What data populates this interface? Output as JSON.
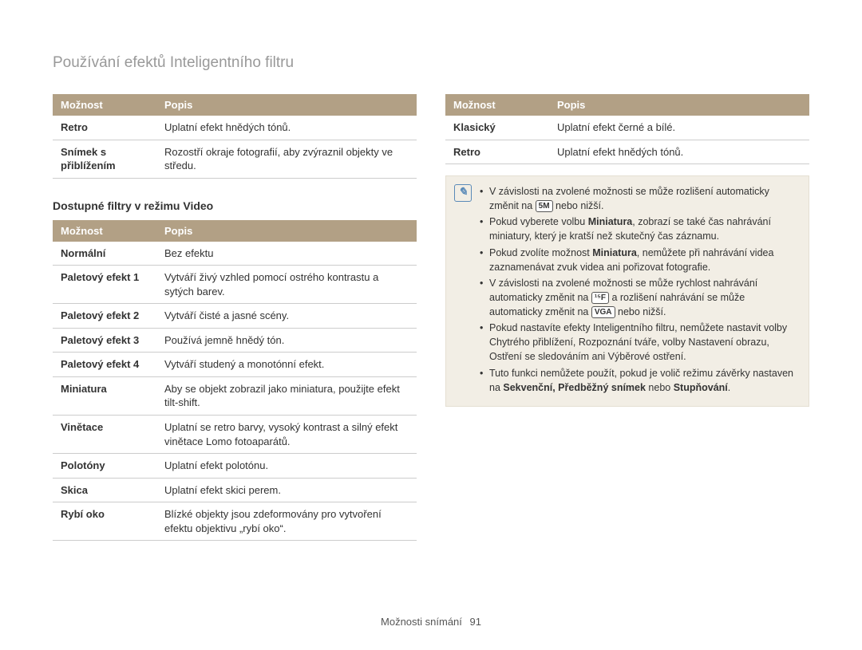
{
  "page_title": "Používání efektů Inteligentního filtru",
  "col_headers": {
    "option": "Možnost",
    "desc": "Popis"
  },
  "table_top_left": [
    {
      "opt": "Retro",
      "desc": "Uplatní efekt hnědých tónů."
    },
    {
      "opt": "Snímek s přiblížením",
      "desc": "Rozostří okraje fotografií, aby zvýraznil objekty ve středu."
    }
  ],
  "subhead_video": "Dostupné filtry v režimu Video",
  "table_video": [
    {
      "opt": "Normální",
      "desc": "Bez efektu"
    },
    {
      "opt": "Paletový efekt 1",
      "desc": "Vytváří živý vzhled pomocí ostrého kontrastu a sytých barev."
    },
    {
      "opt": "Paletový efekt 2",
      "desc": "Vytváří čisté a jasné scény."
    },
    {
      "opt": "Paletový efekt 3",
      "desc": "Používá jemně hnědý tón."
    },
    {
      "opt": "Paletový efekt 4",
      "desc": "Vytváří studený a monotónní efekt."
    },
    {
      "opt": "Miniatura",
      "desc": "Aby se objekt zobrazil jako miniatura, použijte efekt tilt-shift."
    },
    {
      "opt": "Vinětace",
      "desc": "Uplatní se retro barvy, vysoký kontrast a silný efekt vinětace Lomo fotoaparátů."
    },
    {
      "opt": "Polotóny",
      "desc": "Uplatní efekt polotónu."
    },
    {
      "opt": "Skica",
      "desc": "Uplatní efekt skici perem."
    },
    {
      "opt": "Rybí oko",
      "desc": "Blízké objekty jsou zdeformovány pro vytvoření efektu objektivu „rybí oko“."
    }
  ],
  "table_top_right": [
    {
      "opt": "Klasický",
      "desc": "Uplatní efekt černé a bílé."
    },
    {
      "opt": "Retro",
      "desc": "Uplatní efekt hnědých tónů."
    }
  ],
  "notes": {
    "n1a": "V závislosti na zvolené možnosti se může rozlišení automaticky změnit na ",
    "n1badge": "5M",
    "n1b": " nebo nižší.",
    "n2a": "Pokud vyberete volbu ",
    "n2bold": "Miniatura",
    "n2b": ", zobrazí se také čas nahrávání miniatury, který je kratší než skutečný čas záznamu.",
    "n3a": "Pokud zvolíte možnost ",
    "n3bold": "Miniatura",
    "n3b": ", nemůžete při nahrávání videa zaznamenávat zvuk videa ani pořizovat fotografie.",
    "n4a": "V závislosti na zvolené možnosti se může rychlost nahrávání automaticky změnit na ",
    "n4badge1": "¹⁵F",
    "n4b": " a rozlišení nahrávání se může automaticky změnit na ",
    "n4badge2": "VGA",
    "n4c": " nebo nižší.",
    "n5": "Pokud nastavíte efekty Inteligentního filtru, nemůžete nastavit volby Chytrého přiblížení, Rozpoznání tváře, volby Nastavení obrazu, Ostření se sledováním ani Výběrové ostření.",
    "n6a": "Tuto funkci nemůžete použít, pokud je volič režimu závěrky nastaven na ",
    "n6bold": "Sekvenční, Předběžný snímek",
    "n6mid": " nebo ",
    "n6bold2": "Stupňování",
    "n6end": "."
  },
  "footer": {
    "section": "Možnosti snímání",
    "page": "91"
  }
}
